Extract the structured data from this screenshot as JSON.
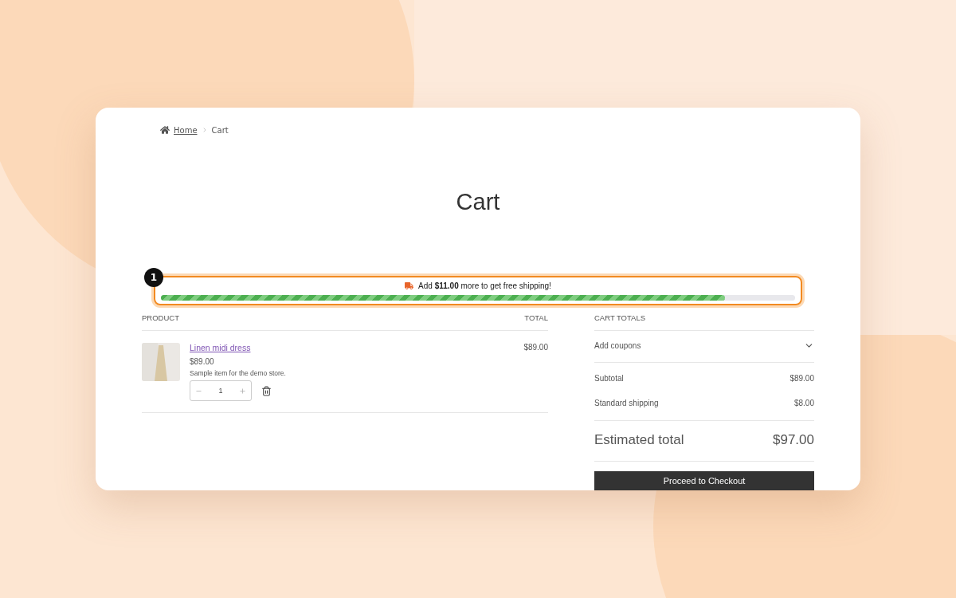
{
  "breadcrumb": [
    {
      "label": "Home",
      "link": true
    },
    {
      "label": "Cart",
      "link": false
    }
  ],
  "title": "Cart",
  "callout": {
    "number": "1"
  },
  "shipping_notice": {
    "text": "Add **$11.00** more to get free shipping!",
    "level": 0.89
  },
  "cart_table": {
    "columns": [
      "PRODUCT",
      "TOTAL"
    ],
    "rows": [
      {
        "name": "Linen midi dress",
        "price": "$89.00",
        "description": "Sample item for the demo store.",
        "quantity": "1",
        "total": "$89.00"
      }
    ]
  },
  "cart_totals": {
    "heading": "CART TOTALS",
    "coupon": {
      "label": "Add coupons",
      "expanded": false
    },
    "lines": [
      {
        "label": "Subtotal",
        "value": "$89.00"
      },
      {
        "label": "Standard shipping",
        "value": "$8.00"
      }
    ],
    "estimated": {
      "label": "Estimated total",
      "value": "$97.00"
    },
    "checkout_button": "Proceed to Checkout"
  }
}
